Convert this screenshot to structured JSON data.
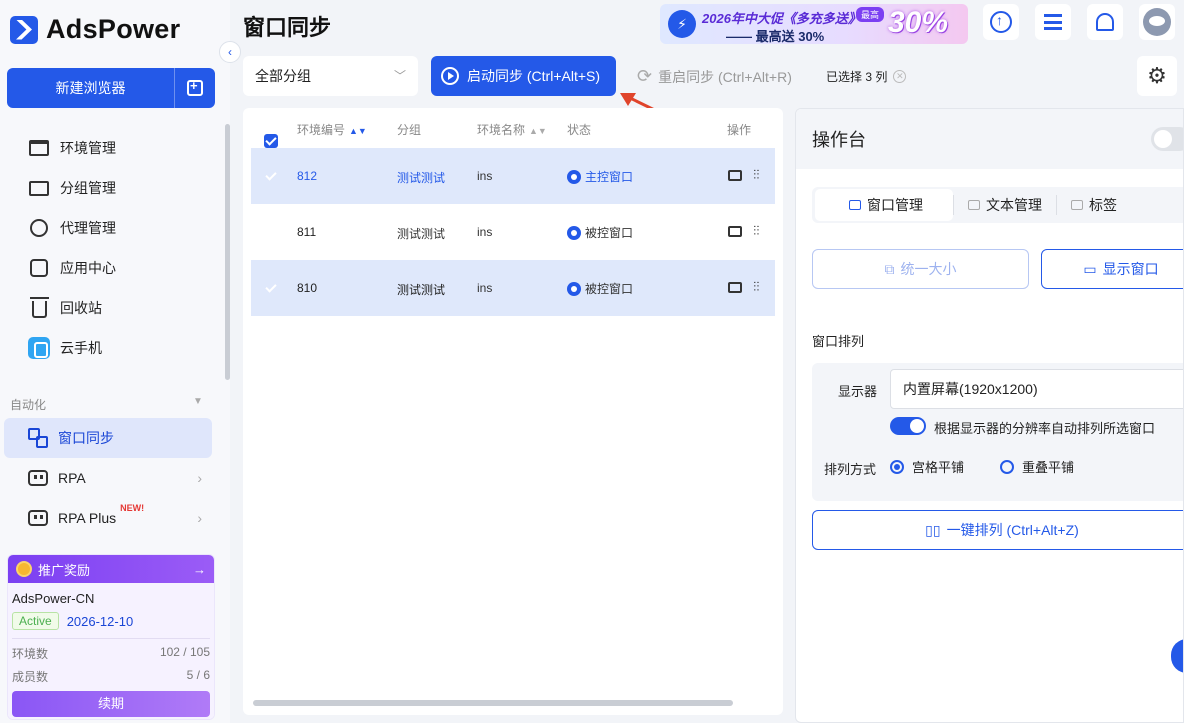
{
  "app": {
    "name": "AdsPower"
  },
  "sidebar": {
    "new_browser": "新建浏览器",
    "items": [
      {
        "label": "环境管理",
        "icon": "window-icon"
      },
      {
        "label": "分组管理",
        "icon": "folder-icon"
      },
      {
        "label": "代理管理",
        "icon": "proxy-icon"
      },
      {
        "label": "应用中心",
        "icon": "app-center-icon"
      },
      {
        "label": "回收站",
        "icon": "trash-icon"
      },
      {
        "label": "云手机",
        "icon": "cloud-phone-icon"
      }
    ],
    "section": "自动化",
    "automation": [
      {
        "label": "窗口同步",
        "active": true
      },
      {
        "label": "RPA"
      },
      {
        "label": "RPA Plus",
        "tag": "NEW!"
      }
    ],
    "promo": {
      "title": "推广奖励",
      "account": "AdsPower-CN",
      "status": "Active",
      "expire": "2026-12-10",
      "env_label": "环境数",
      "env_value": "102 / 105",
      "member_label": "成员数",
      "member_value": "5 / 6",
      "renew": "续期"
    }
  },
  "header": {
    "title": "窗口同步",
    "banner": {
      "line1": "2026年中大促《多充多送》",
      "line2": "—— 最高送 30%",
      "tag": "最高",
      "big": "30%"
    }
  },
  "toolbar": {
    "group": "全部分组",
    "start": "启动同步 (Ctrl+Alt+S)",
    "restart": "重启同步 (Ctrl+Alt+R)",
    "selected": "已选择 3 列"
  },
  "table": {
    "headers": {
      "id": "环境编号",
      "group": "分组",
      "name": "环境名称",
      "status": "状态",
      "ops": "操作"
    },
    "rows": [
      {
        "id": "812",
        "group": "测试测试",
        "name": "ins",
        "status": "主控窗口"
      },
      {
        "id": "811",
        "group": "测试测试",
        "name": "ins",
        "status": "被控窗口"
      },
      {
        "id": "810",
        "group": "测试测试",
        "name": "ins",
        "status": "被控窗口"
      }
    ]
  },
  "console": {
    "title": "操作台",
    "tabs": [
      "窗口管理",
      "文本管理",
      "标签"
    ],
    "uniform_size": "统一大小",
    "show_window": "显示窗口",
    "arrange_label": "窗口排列",
    "display_label": "显示器",
    "display_value": "内置屏幕(1920x1200)",
    "auto_arrange": "根据显示器的分辨率自动排列所选窗口",
    "mode_label": "排列方式",
    "mode_grid": "宫格平铺",
    "mode_overlap": "重叠平铺",
    "one_key": "一键排列 (Ctrl+Alt+Z)"
  },
  "colors": {
    "primary": "#2459e8",
    "promo": "#7b3ff2",
    "active_badge": "#4caf50"
  }
}
